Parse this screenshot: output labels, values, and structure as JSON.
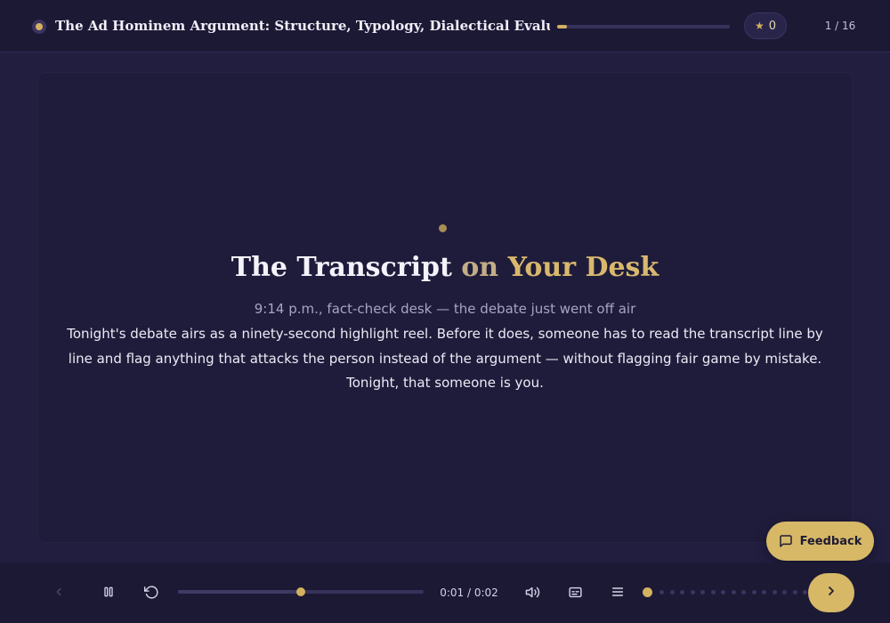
{
  "header": {
    "course_title": "The Ad Hominem Argument: Structure, Typology, Dialectical Evaluation",
    "course_progress_fraction": 0.055,
    "stars_count": "0",
    "slide_counter": "1 / 16"
  },
  "slide": {
    "title_part1": "The Transcript",
    "title_part2": "on",
    "title_part3": "Your Desk",
    "subtitle": "9:14 p.m., fact-check desk — the debate just went off air",
    "body": "Tonight's debate airs as a ninety-second highlight reel. Before it does, someone has to read the transcript line by line and flag anything that attacks the person instead of the argument — without flagging fair game by mistake. Tonight, that someone is you."
  },
  "feedback": {
    "label": "Feedback",
    "icon": "message-square-icon"
  },
  "player": {
    "icons": [
      "chevron-left-icon",
      "pause-icon",
      "replay-icon",
      "volume-icon",
      "captions-icon",
      "menu-icon",
      "chevron-right-icon"
    ],
    "playback_fraction": 0.5,
    "time": "0:01 / 0:02",
    "slide_total": 16,
    "current_slide_index": 0
  },
  "colors": {
    "accent": "#d4b15f",
    "background": "#221e40",
    "card": "#1f1c3b",
    "bar": "#1c1935"
  }
}
